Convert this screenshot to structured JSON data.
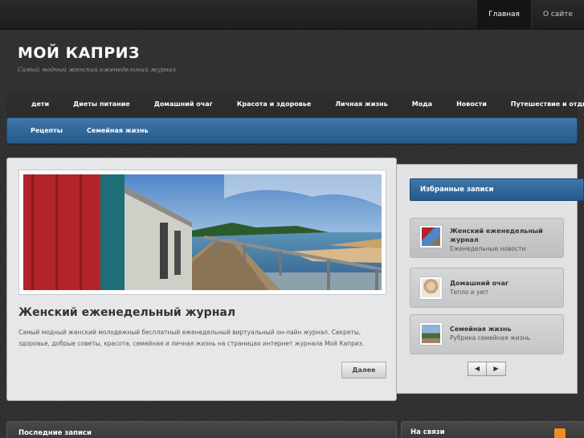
{
  "top_nav": [
    {
      "label": "Главная",
      "active": true
    },
    {
      "label": "О сайте",
      "active": false
    }
  ],
  "site": {
    "title": "МОЙ КАПРИЗ",
    "description": "Самый модный женский еженедельный журнал"
  },
  "main_nav": {
    "row1": [
      "дети",
      "Диеты питание",
      "Домашний очаг",
      "Красота и здоровье",
      "Личная жизнь",
      "Мода",
      "Новости",
      "Путешествие и отдых"
    ],
    "row2": [
      "Рецепты",
      "Семейная жизнь"
    ]
  },
  "featured": {
    "title": "Женский еженедельный журнал",
    "text": "Самый модный женский молодежный бесплатный еженедельный виртуальный он-лайн журнал. Секреты, здоровье, добрые советы, красота, семейная и личная жизнь на страницах интернет журнала Мой Каприз.",
    "more_label": "Далее"
  },
  "sidebar": {
    "heading": "Избранные записи",
    "items": [
      {
        "title": "Женский еженедельный журнал",
        "subtitle": "Еженедельные новости",
        "icon": "boardwalk-thumbnail"
      },
      {
        "title": "Домашний очаг",
        "subtitle": "Тепло и уют",
        "icon": "woman-portrait-thumbnail"
      },
      {
        "title": "Семейная жизнь",
        "subtitle": "Рубрика семейная жизнь",
        "icon": "landscape-thumbnail"
      }
    ],
    "prev_icon": "◀",
    "next_icon": "▶"
  },
  "bottom": {
    "recent_label": "Последние записи",
    "contact_label": "На связи"
  },
  "colors": {
    "accent_blue": "#2e6698",
    "rss_orange": "#f28c1e",
    "panel_bg": "#e6e7e9"
  }
}
